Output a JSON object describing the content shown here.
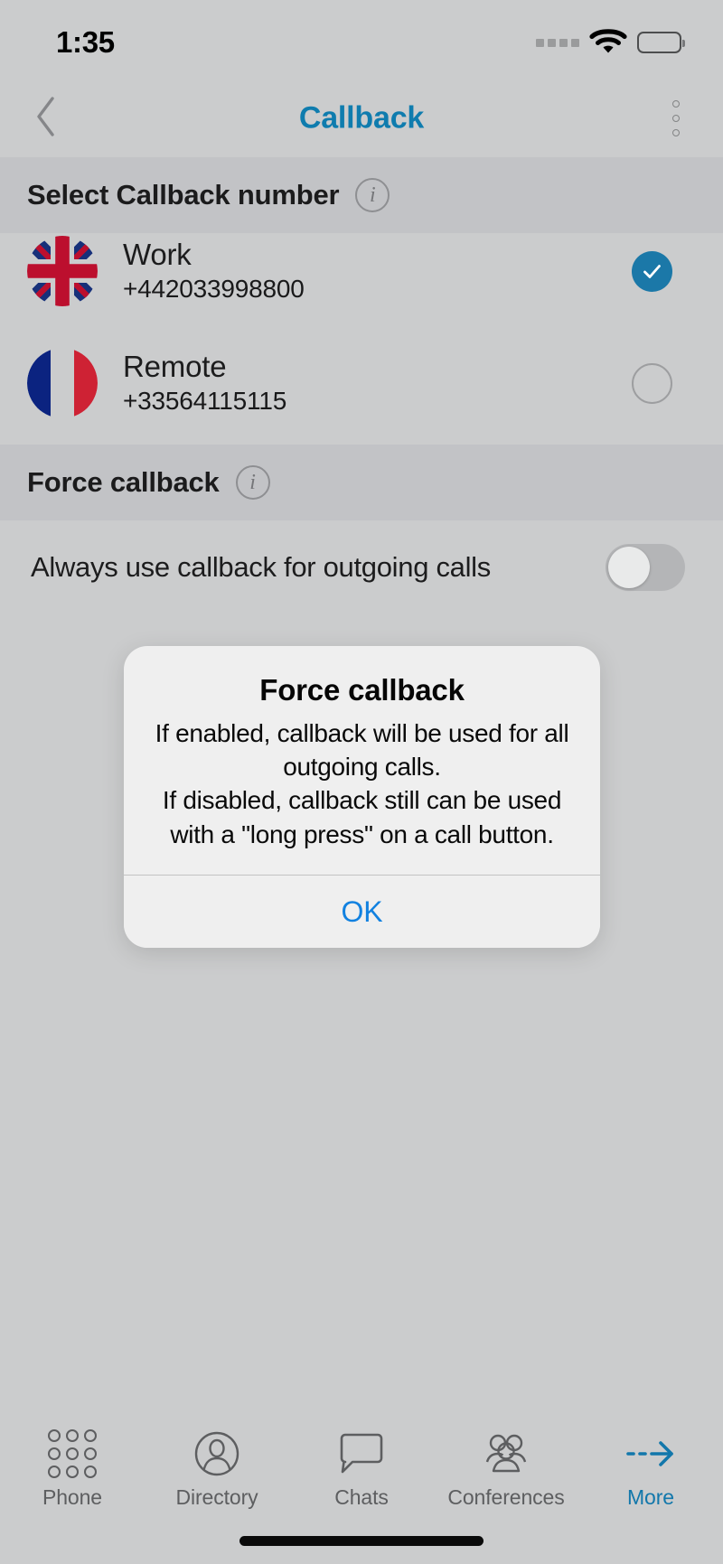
{
  "status_bar": {
    "time": "1:35",
    "signal_icon": "signal-dots-icon",
    "wifi_icon": "wifi-icon",
    "battery_icon": "battery-full-icon"
  },
  "nav_bar": {
    "back_icon": "chevron-left-icon",
    "title": "Callback",
    "menu_icon": "more-vertical-icon",
    "title_color": "#0f7cae"
  },
  "sections": {
    "select_number": {
      "title": "Select Callback number",
      "info_icon": "info-icon",
      "info_glyph": "i"
    },
    "force_callback": {
      "title": "Force callback",
      "info_icon": "info-icon",
      "info_glyph": "i"
    }
  },
  "numbers": [
    {
      "flag": "uk-flag-icon",
      "country": "United Kingdom",
      "label": "Work",
      "number": "+442033998800",
      "selected": true,
      "indicator_icon": "check-circle-icon"
    },
    {
      "flag": "france-flag-icon",
      "country": "France",
      "label": "Remote",
      "number": "+33564115115",
      "selected": false,
      "indicator_icon": "empty-circle-icon"
    }
  ],
  "force_callback_row": {
    "label": "Always use callback for outgoing calls",
    "toggle_state": "off",
    "toggle_icon": "toggle-switch-off-icon"
  },
  "dialog": {
    "title": "Force callback",
    "message": "If enabled, callback will be used for all outgoing calls.\nIf disabled, callback still can be used with a \"long press\" on a call button.",
    "ok_label": "OK",
    "ok_color": "#1181e0"
  },
  "tab_bar": {
    "items": [
      {
        "label": "Phone",
        "icon": "keypad-icon",
        "active": false
      },
      {
        "label": "Directory",
        "icon": "contact-person-icon",
        "active": false
      },
      {
        "label": "Chats",
        "icon": "speech-bubble-icon",
        "active": false
      },
      {
        "label": "Conferences",
        "icon": "people-group-icon",
        "active": false
      },
      {
        "label": "More",
        "icon": "dashed-arrow-right-icon",
        "active": true
      }
    ],
    "active_color": "#1277ab"
  },
  "home_indicator": "home-indicator-bar",
  "colors": {
    "background": "#cbcccd",
    "section_band": "#c2c3c6",
    "accent_blue": "#0f7cae",
    "selected_blue": "#1b78a8"
  }
}
